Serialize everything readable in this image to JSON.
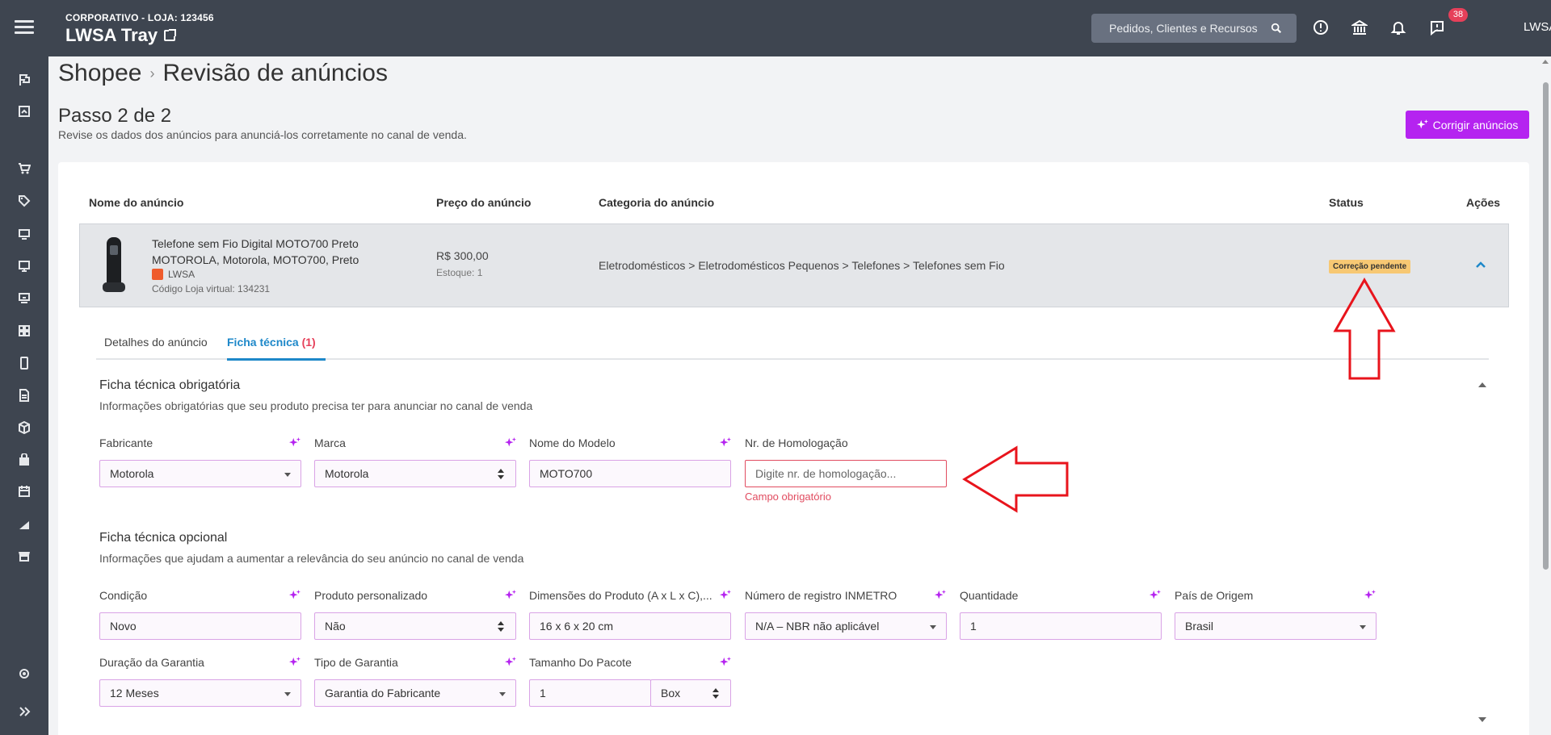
{
  "header": {
    "store_subtitle": "CORPORATIVO - LOJA: 123456",
    "store_name": "LWSA Tray",
    "search_placeholder": "Pedidos, Clientes e Recursos",
    "notifications_count": "38",
    "user_label": "LWSA"
  },
  "breadcrumb": {
    "root": "Shopee",
    "separator": "›",
    "current": "Revisão de anúncios"
  },
  "step": {
    "title": "Passo 2 de 2",
    "description": "Revise os dados dos anúncios para anunciá-los corretamente no canal de venda.",
    "fix_button": "Corrigir anúncios"
  },
  "table": {
    "columns": {
      "name": "Nome do anúncio",
      "price": "Preço do anúncio",
      "category": "Categoria do anúncio",
      "status": "Status",
      "actions": "Ações"
    },
    "row": {
      "name_line1": "Telefone sem Fio Digital MOTO700 Preto",
      "name_line2": "MOTOROLA, Motorola, MOTO700, Preto",
      "seller": "LWSA",
      "code": "Código Loja virtual: 134231",
      "price": "R$ 300,00",
      "stock": "Estoque: 1",
      "category": "Eletrodomésticos > Eletrodomésticos Pequenos > Telefones > Telefones sem Fio",
      "status": "Correção pendente"
    }
  },
  "tabs": {
    "details": "Detalhes do anúncio",
    "sheet": "Ficha técnica",
    "sheet_count": "(1)"
  },
  "mandatory": {
    "title": "Ficha técnica obrigatória",
    "description": "Informações obrigatórias que seu produto precisa ter para anunciar no canal de venda",
    "fabricante_label": "Fabricante",
    "fabricante_value": "Motorola",
    "marca_label": "Marca",
    "marca_value": "Motorola",
    "modelo_label": "Nome do Modelo",
    "modelo_value": "MOTO700",
    "homologacao_label": "Nr. de Homologação",
    "homologacao_placeholder": "Digite nr. de homologação...",
    "homologacao_error": "Campo obrigatório"
  },
  "optional": {
    "title": "Ficha técnica opcional",
    "description": "Informações que ajudam a aumentar a relevância do seu anúncio no canal de venda",
    "condicao_label": "Condição",
    "condicao_value": "Novo",
    "personalizado_label": "Produto personalizado",
    "personalizado_value": "Não",
    "dimensoes_label": "Dimensões do Produto (A x L x C),...",
    "dimensoes_value": "16 x 6 x 20 cm",
    "inmetro_label": "Número de registro INMETRO",
    "inmetro_value": "N/A – NBR não aplicável",
    "quantidade_label": "Quantidade",
    "quantidade_value": "1",
    "pais_label": "País de Origem",
    "pais_value": "Brasil",
    "garantia_label": "Duração da Garantia",
    "garantia_value": "12 Meses",
    "tipo_garantia_label": "Tipo de Garantia",
    "tipo_garantia_value": "Garantia do Fabricante",
    "pacote_label": "Tamanho Do Pacote",
    "pacote_value": "1",
    "pacote_unit": "Box"
  },
  "colors": {
    "sidebar": "#3e4550",
    "accent_purple": "#b523f0",
    "tab_blue": "#1e88c9",
    "error_red": "#e14c60",
    "status_badge": "#f7c873",
    "annotation_arrow": "#e8141c"
  }
}
